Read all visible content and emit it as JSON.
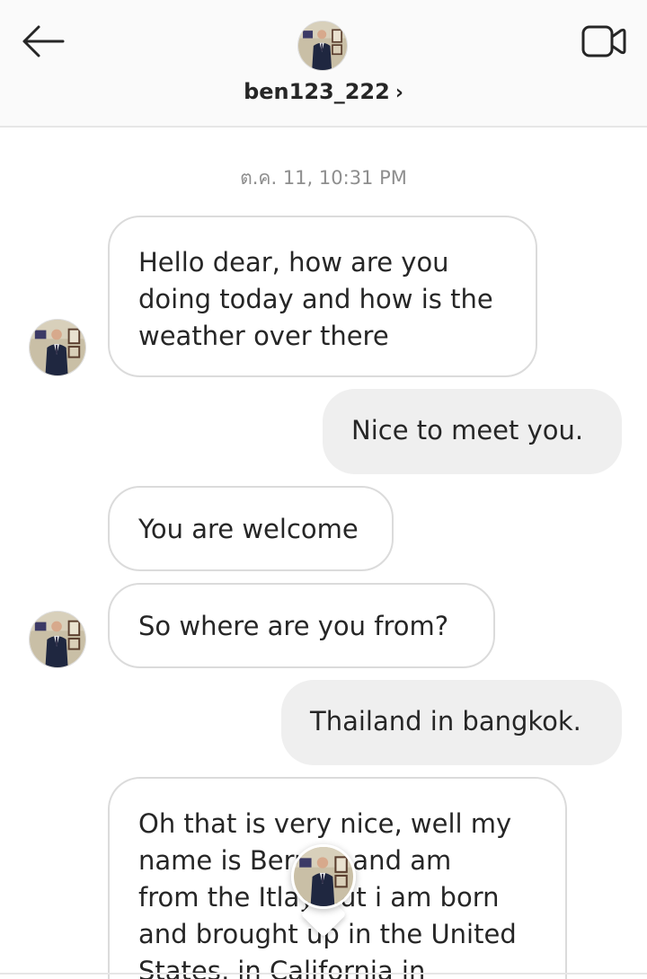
{
  "header": {
    "username": "ben123_222",
    "chevron": "›",
    "back_icon": "arrow-left-icon",
    "video_icon": "video-camera-icon"
  },
  "chat": {
    "timestamp": "ต.ค. 11, 10:31 PM",
    "messages": [
      {
        "direction": "incoming",
        "lines": [
          "Hello dear, how are you",
          "doing today and how is the",
          "weather over there"
        ]
      },
      {
        "direction": "outgoing",
        "lines": [
          "Nice to meet you."
        ]
      },
      {
        "direction": "incoming",
        "lines": [
          "You are welcome"
        ]
      },
      {
        "direction": "incoming",
        "lines": [
          "So where are you from?"
        ]
      },
      {
        "direction": "outgoing",
        "lines": [
          "Thailand in bangkok."
        ]
      },
      {
        "direction": "incoming",
        "lines": [
          "Oh that is very nice, well my",
          "name is Bernier and am",
          "from the Itlay but i am born",
          "and brought up in the United",
          "States, in California in"
        ]
      }
    ]
  },
  "colors": {
    "header_bg": "#fafafa",
    "incoming_bg": "#ffffff",
    "incoming_border": "#dbdbdb",
    "outgoing_bg": "#efefef",
    "timestamp": "#8e8e8e",
    "text": "#262626"
  }
}
